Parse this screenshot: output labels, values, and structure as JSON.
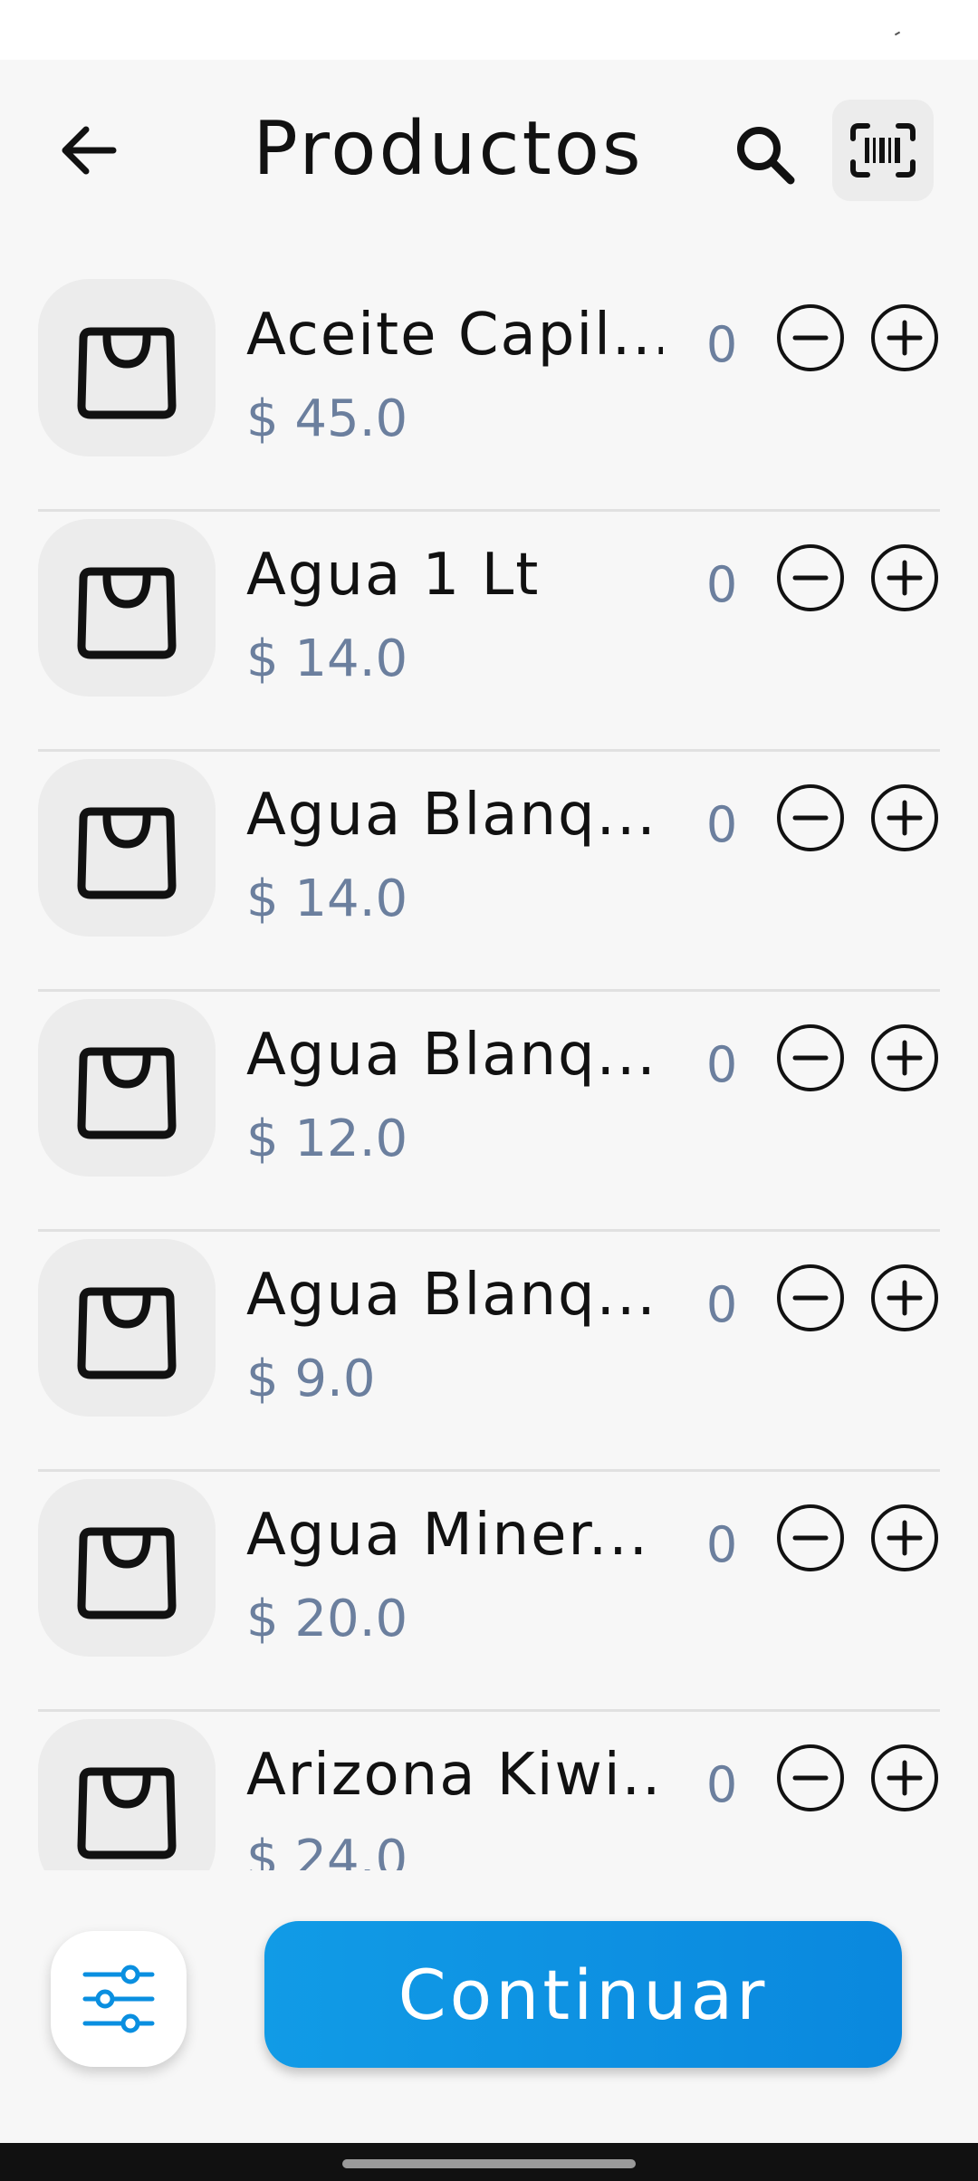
{
  "header": {
    "title": "Productos",
    "back_icon": "arrow-left-icon",
    "search_icon": "search-icon",
    "barcode_icon": "barcode-scan-icon"
  },
  "products": [
    {
      "name": "Aceite Capil...",
      "price": "$ 45.0",
      "qty": "0"
    },
    {
      "name": "Agua 1 Lt",
      "price": "$ 14.0",
      "qty": "0"
    },
    {
      "name": "Agua Blanq...",
      "price": "$ 14.0",
      "qty": "0"
    },
    {
      "name": "Agua Blanq...",
      "price": "$ 12.0",
      "qty": "0"
    },
    {
      "name": "Agua Blanq...",
      "price": "$ 9.0",
      "qty": "0"
    },
    {
      "name": "Agua Miner...",
      "price": "$ 20.0",
      "qty": "0"
    },
    {
      "name": "Arizona Kiwi...",
      "price": "$ 24.0",
      "qty": "0"
    }
  ],
  "footer": {
    "continue_label": "Continuar",
    "filter_icon": "sliders-icon"
  },
  "colors": {
    "accent": "#0a8fe0",
    "price": "#6b7f9e",
    "background": "#f7f7f7"
  }
}
